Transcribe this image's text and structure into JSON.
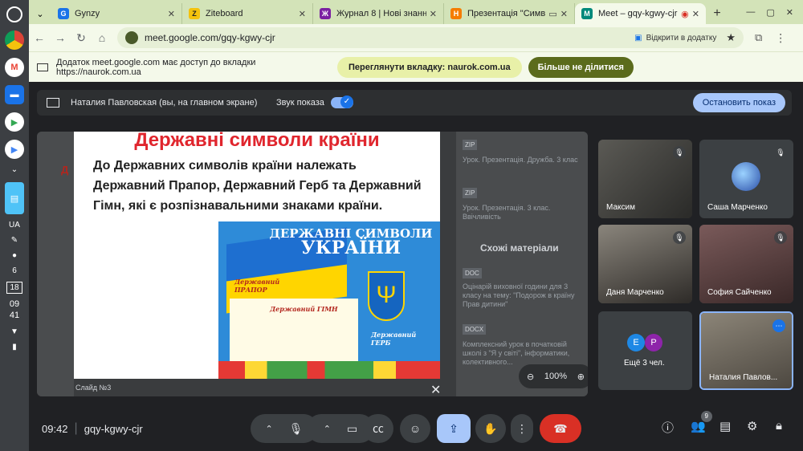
{
  "shelf": {
    "apps": [
      {
        "name": "chrome-icon",
        "color": "#db4437"
      },
      {
        "name": "gmail-icon",
        "color": "#ea4335"
      },
      {
        "name": "files-icon",
        "color": "#1a73e8"
      },
      {
        "name": "meet-icon",
        "color": "#34a853"
      },
      {
        "name": "play-icon",
        "color": "#4285f4"
      }
    ],
    "lang": "UA",
    "notif_count": "6",
    "calendar_day": "18",
    "time_hour": "09",
    "time_min": "41"
  },
  "tabs": [
    {
      "label": "Gynzy",
      "icon": "gynzy-icon",
      "color": "#1a73e8",
      "glyph": "G"
    },
    {
      "label": "Ziteboard",
      "icon": "ziteboard-icon",
      "color": "#f4c20d",
      "glyph": "Z"
    },
    {
      "label": "Журнал 8 | Нові знання",
      "icon": "journal-icon",
      "color": "#7b1fa2",
      "glyph": "Ж"
    },
    {
      "label": "Презентація \"Символи",
      "icon": "naurok-icon",
      "color": "#f57c00",
      "glyph": "Н"
    },
    {
      "label": "Meet – gqy-kgwy-cjr",
      "icon": "meet-tab-icon",
      "color": "#00897b",
      "glyph": "M"
    }
  ],
  "address": {
    "url": "meet.google.com/gqy-kgwy-cjr",
    "open_in_app": "Відкрити в додатку"
  },
  "share_bar": {
    "text": "Додаток meet.google.com має доступ до вкладки https://naurok.com.ua",
    "view_tab": "Переглянути вкладку: naurok.com.ua",
    "stop_sharing": "Більше не ділитися"
  },
  "presenting": {
    "label": "Наталия Павловская (вы, на главном экране)",
    "sound_label": "Звук показа",
    "stop_button": "Остановить показ"
  },
  "slide": {
    "title": "Державні символи країни",
    "body": "До Державних символів країни належать Державний Прапор, Державний Герб та Державний Гімн, які є розпізнавальними знаками країни.",
    "poster_line1": "ДЕРЖАВНІ СИМВОЛИ",
    "poster_line2": "УКРАЇНИ",
    "flag_label": "Державний ПРАПОР",
    "anthem_label": "Державний ГІМН",
    "coat_label": "Державний ГЕРБ",
    "slide_label": "Слайд №3",
    "zoom": "100%"
  },
  "background_page": {
    "tag1": "ZIP",
    "item1": "Урок. Презентація. Дружба. 3 клас",
    "tag2": "ZIP",
    "item2": "Урок. Презентація. 3 клас. Ввічливість",
    "similar": "Схожі матеріали",
    "tag3": "DOC",
    "item3": "Оцінарій виховної години для 3 класу на тему: \"Подорож в країну Прав дитини\"",
    "tag4": "DOCX",
    "item4": "Комплексний урок в початковій школі з \"Я у світі\", інформатики, колективного...",
    "left_title": "Д"
  },
  "participants": [
    {
      "name": "Максим",
      "bg": "#3b3a38"
    },
    {
      "name": "Саша Марченко",
      "bg": "#3c4043"
    },
    {
      "name": "Даня Марченко",
      "bg": "#5b5650"
    },
    {
      "name": "София Сайченко",
      "bg": "#6a4a4a"
    },
    {
      "name": "Ещё 3 чел.",
      "bg": "#3c4043"
    },
    {
      "name": "Наталия Павлов...",
      "bg": "#6d6a64"
    }
  ],
  "more_avatars": [
    {
      "letter": "Е",
      "color": "#1e88e5"
    },
    {
      "letter": "Р",
      "color": "#8e24aa"
    }
  ],
  "controls": {
    "clock": "09:42",
    "meeting_code": "gqy-kgwy-cjr",
    "people_count": "9"
  }
}
